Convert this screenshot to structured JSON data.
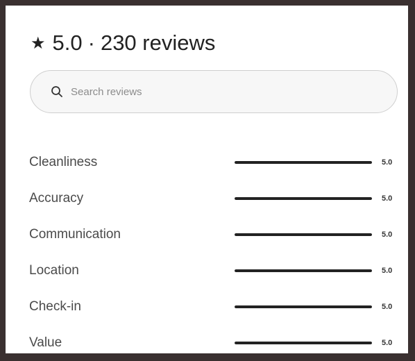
{
  "header": {
    "star_icon": "star-icon",
    "rating": "5.0",
    "separator": "·",
    "reviews_count": "230 reviews"
  },
  "search": {
    "icon": "search-icon",
    "value": "",
    "placeholder": "Search reviews"
  },
  "ratings": [
    {
      "label": "Cleanliness",
      "value": "5.0",
      "fraction": 1.0
    },
    {
      "label": "Accuracy",
      "value": "5.0",
      "fraction": 1.0
    },
    {
      "label": "Communication",
      "value": "5.0",
      "fraction": 1.0
    },
    {
      "label": "Location",
      "value": "5.0",
      "fraction": 1.0
    },
    {
      "label": "Check-in",
      "value": "5.0",
      "fraction": 1.0
    },
    {
      "label": "Value",
      "value": "5.0",
      "fraction": 1.0
    }
  ],
  "colors": {
    "text_primary": "#222222",
    "bar_fill": "#222222",
    "bar_track": "#dddddd",
    "search_bg": "#f7f7f7",
    "frame": "#3a3030"
  }
}
